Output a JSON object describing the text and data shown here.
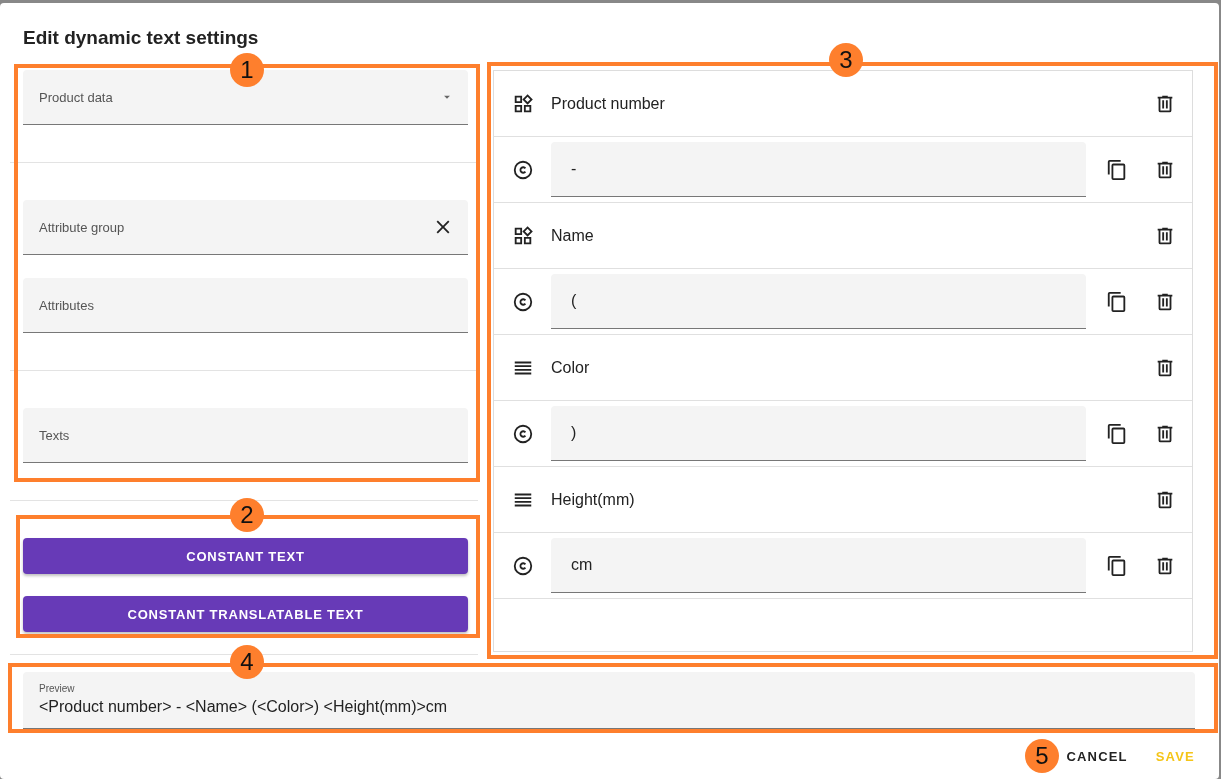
{
  "dialog": {
    "title": "Edit dynamic text settings"
  },
  "left": {
    "sections": [
      {
        "fields": [
          {
            "kind": "select",
            "label": "Product data"
          }
        ]
      },
      {
        "fields": [
          {
            "kind": "clearable",
            "label": "Attribute group"
          },
          {
            "kind": "plain",
            "label": "Attributes"
          }
        ]
      },
      {
        "fields": [
          {
            "kind": "plain",
            "label": "Texts"
          }
        ]
      }
    ],
    "buttons": [
      {
        "label": "CONSTANT TEXT"
      },
      {
        "label": "CONSTANT TRANSLATABLE TEXT"
      }
    ]
  },
  "items": [
    {
      "kind": "attribute",
      "label": "Product number"
    },
    {
      "kind": "constant",
      "value": "-"
    },
    {
      "kind": "attribute",
      "label": "Name"
    },
    {
      "kind": "constant",
      "value": "("
    },
    {
      "kind": "text",
      "label": "Color"
    },
    {
      "kind": "constant",
      "value": ")"
    },
    {
      "kind": "text",
      "label": "Height(mm)"
    },
    {
      "kind": "constant",
      "value": "cm"
    }
  ],
  "preview": {
    "label": "Preview",
    "value": "<Product number> - <Name> (<Color>) <Height(mm)>cm"
  },
  "actions": [
    {
      "kind": "neutral",
      "label": "CANCEL"
    },
    {
      "kind": "accent",
      "label": "SAVE"
    }
  ],
  "callouts": [
    {
      "number": "1"
    },
    {
      "number": "2"
    },
    {
      "number": "3"
    },
    {
      "number": "4"
    },
    {
      "number": "5"
    }
  ]
}
